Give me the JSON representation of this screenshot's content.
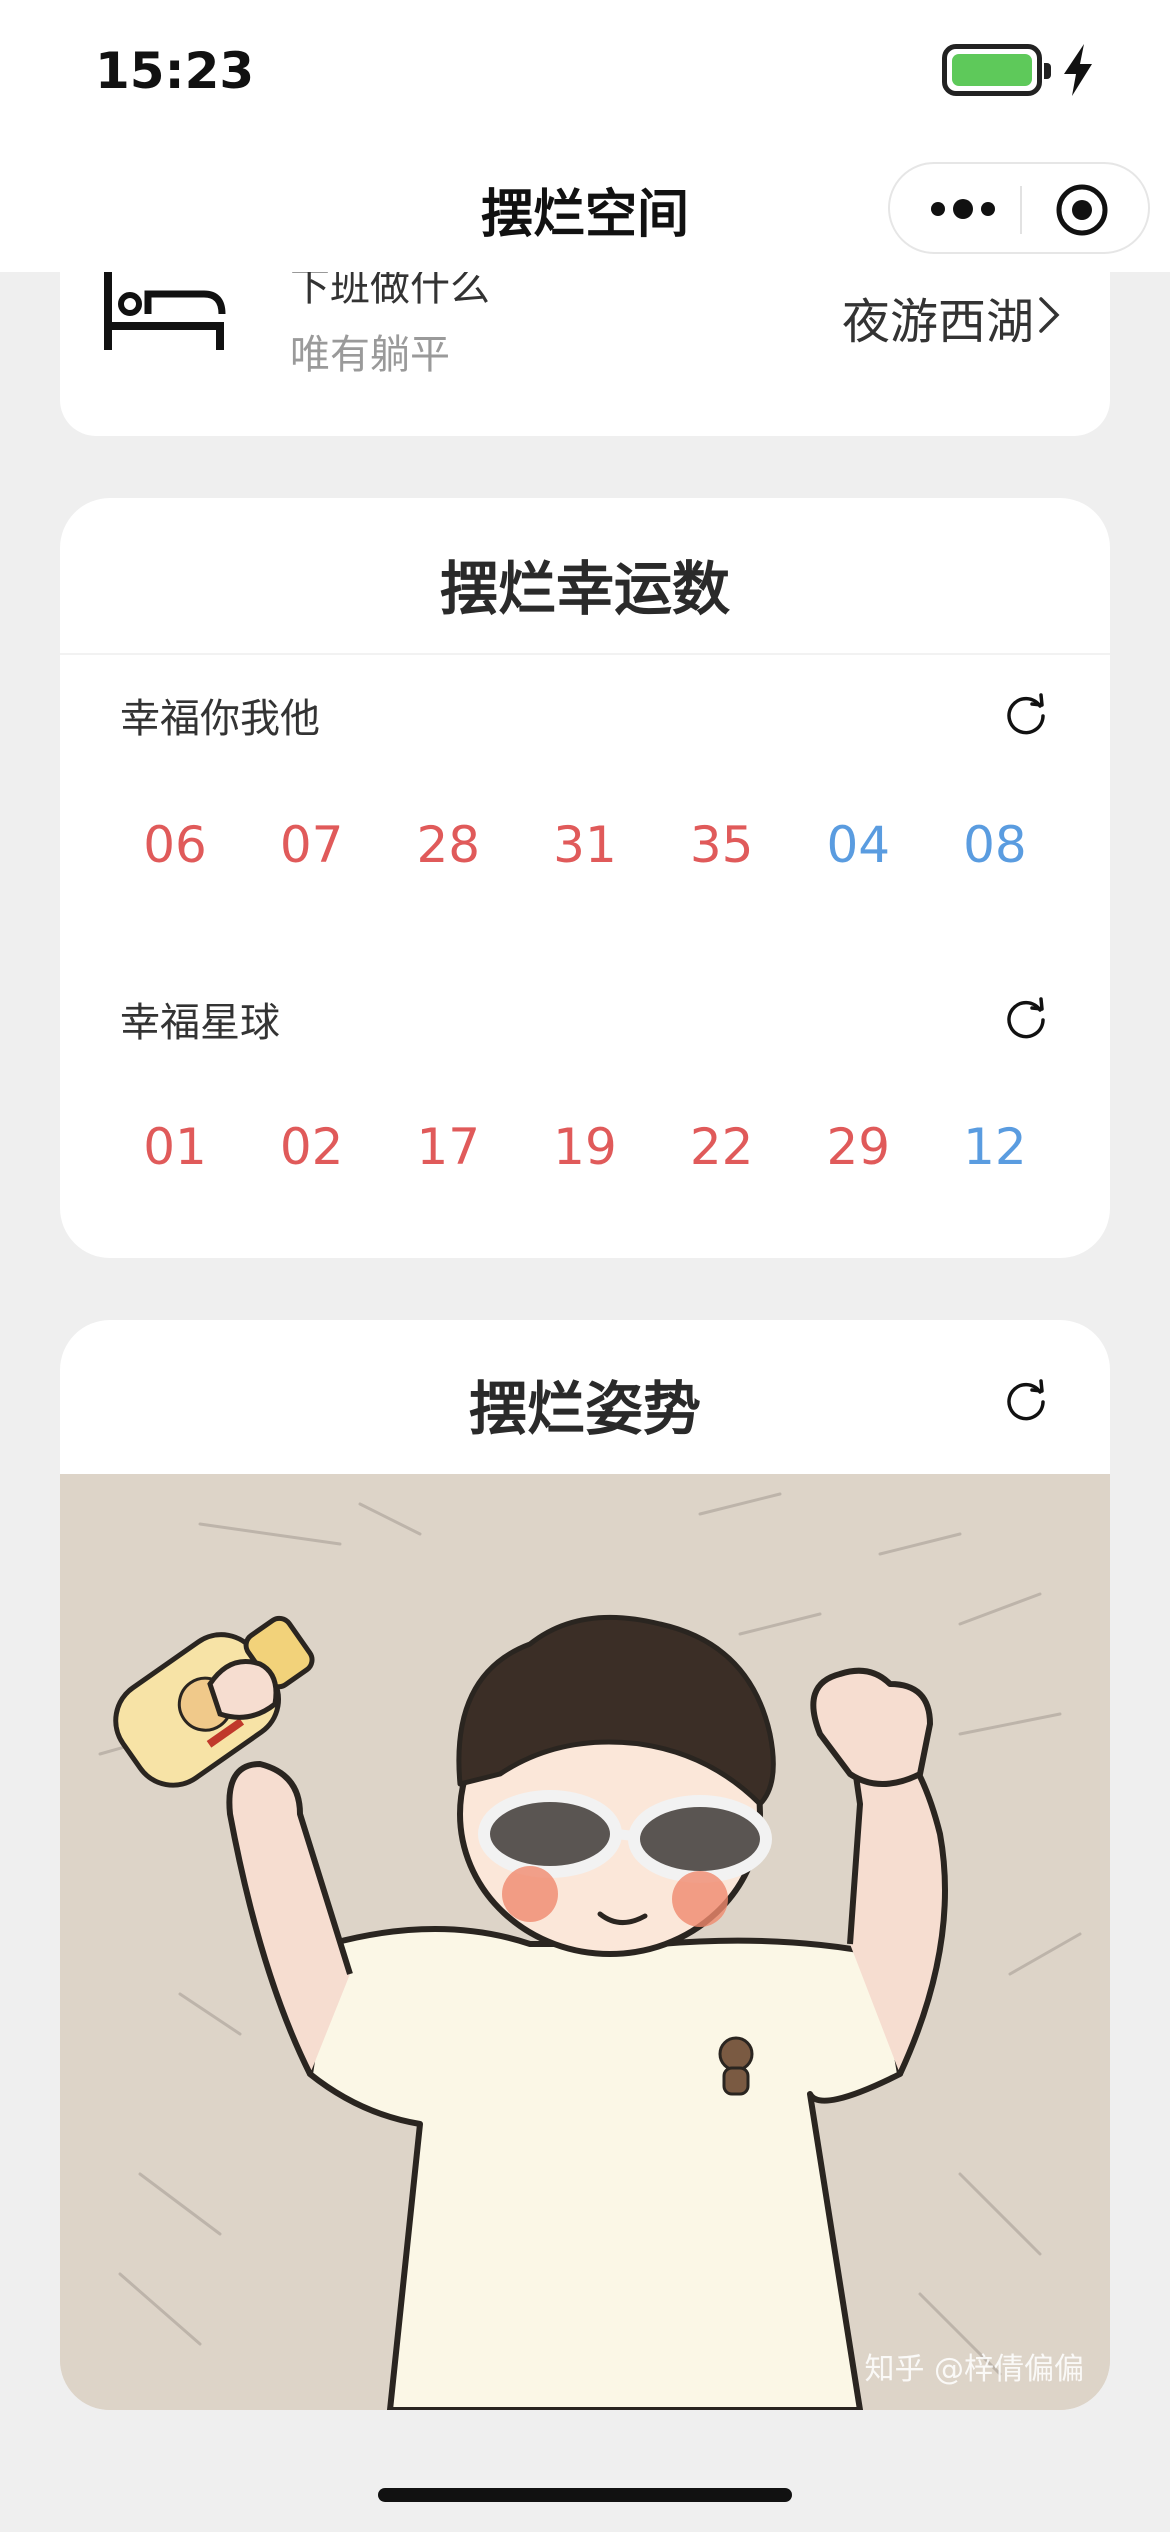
{
  "status_bar": {
    "time": "15:23"
  },
  "nav": {
    "title": "摆烂空间"
  },
  "top_card": {
    "line1": "下班做什么",
    "line2": "唯有躺平",
    "link": "夜游西湖"
  },
  "lucky_card": {
    "title": "摆烂幸运数",
    "groups": [
      {
        "label": "幸福你我他",
        "numbers": [
          "06",
          "07",
          "28",
          "31",
          "35",
          "04",
          "08"
        ],
        "colors": [
          "red",
          "red",
          "red",
          "red",
          "red",
          "blue",
          "blue"
        ]
      },
      {
        "label": "幸福星球",
        "numbers": [
          "01",
          "02",
          "17",
          "19",
          "22",
          "29",
          "12"
        ],
        "colors": [
          "red",
          "red",
          "red",
          "red",
          "red",
          "red",
          "blue"
        ]
      }
    ]
  },
  "pose_card": {
    "title": "摆烂姿势",
    "watermark": "知乎 @梓倩偏偏"
  },
  "colors": {
    "red_number": "#e05a5a",
    "blue_number": "#5a9ce0",
    "background": "#efefef"
  }
}
